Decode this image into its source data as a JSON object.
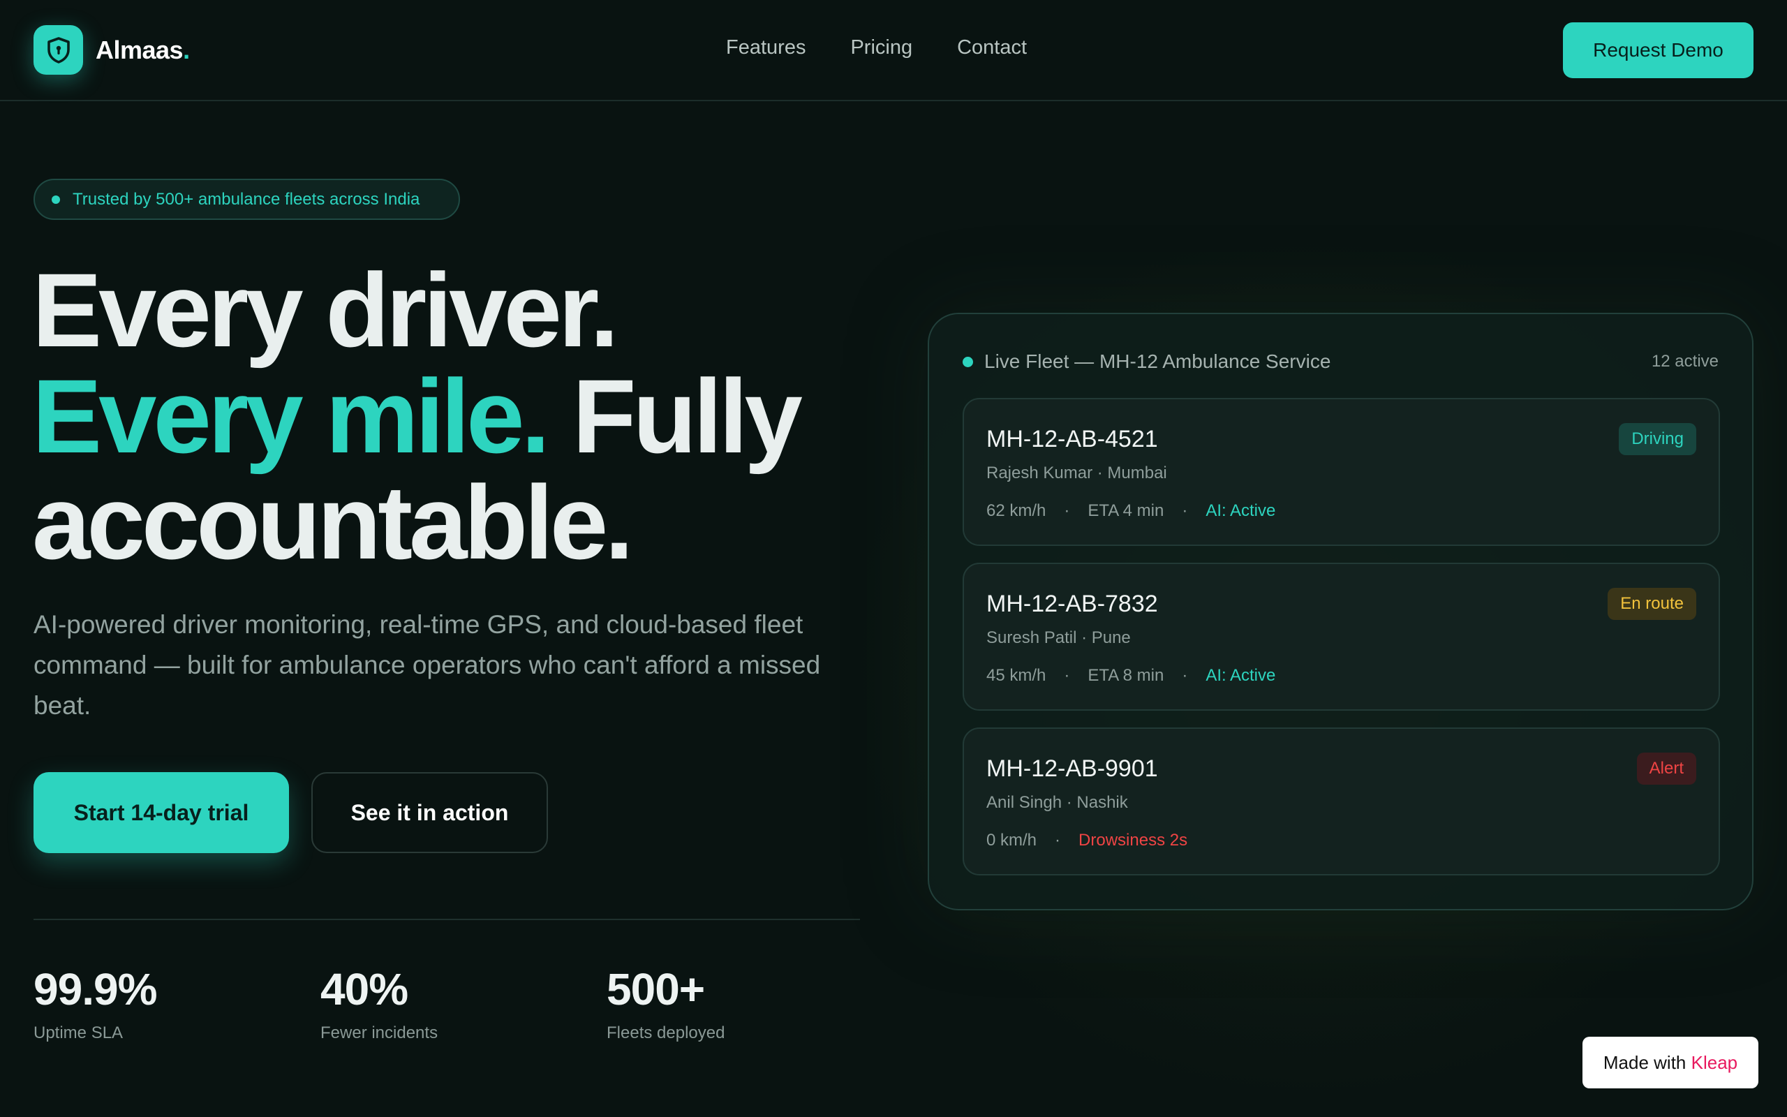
{
  "nav": {
    "brand": "Almaas",
    "brand_dot": ".",
    "links": [
      "Features",
      "Pricing",
      "Contact"
    ],
    "demo_label": "Request Demo"
  },
  "hero": {
    "badge": "Trusted by 500+ ambulance fleets across India",
    "headline_1": "Every driver.",
    "headline_2_teal": "Every mile.",
    "headline_2_white": "Fully",
    "headline_3": "accountable.",
    "subtitle": "AI-powered driver monitoring, real-time GPS, and cloud-based fleet command — built for ambulance operators who can't afford a missed beat.",
    "cta_primary": "Start 14-day trial",
    "cta_secondary": "See it in action"
  },
  "stats": [
    {
      "value": "99.9%",
      "label": "Uptime SLA"
    },
    {
      "value": "40%",
      "label": "Fewer incidents"
    },
    {
      "value": "500+",
      "label": "Fleets deployed"
    }
  ],
  "fleet": {
    "title": "Live Fleet — MH-12 Ambulance Service",
    "count": "12 active",
    "vehicles": [
      {
        "plate": "MH-12-AB-4521",
        "driver": "Rajesh Kumar · Mumbai",
        "speed": "62 km/h",
        "eta": "ETA 4 min",
        "ai": "AI: Active",
        "status": "Driving"
      },
      {
        "plate": "MH-12-AB-7832",
        "driver": "Suresh Patil · Pune",
        "speed": "45 km/h",
        "eta": "ETA 8 min",
        "ai": "AI: Active",
        "status": "En route"
      },
      {
        "plate": "MH-12-AB-9901",
        "driver": "Anil Singh · Nashik",
        "speed": "0 km/h",
        "alert_text": "Drowsiness 2s",
        "status": "Alert"
      }
    ]
  },
  "footer_badge": {
    "prefix": "Made with",
    "brand": "Kleap"
  },
  "colors": {
    "accent": "#2dd4bf",
    "background": "#091311",
    "warning": "#f2c23c",
    "danger": "#ef4444"
  },
  "icons": {
    "logo": "shield-icon"
  }
}
